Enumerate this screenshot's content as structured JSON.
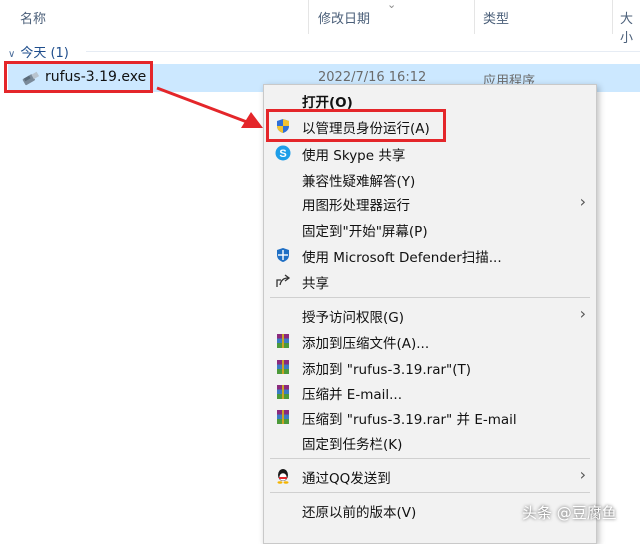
{
  "columns": {
    "name": "名称",
    "modified": "修改日期",
    "type": "类型",
    "size": "大小"
  },
  "group": {
    "label": "今天 (1)"
  },
  "file": {
    "name": "rufus-3.19.exe",
    "date": "2022/7/16 16:12",
    "type": "应用程序"
  },
  "menu": {
    "items": [
      {
        "label": "打开(O)",
        "icon": ""
      },
      {
        "label": "以管理员身份运行(A)",
        "icon": "uac-shield-icon"
      },
      {
        "label": "使用 Skype 共享",
        "icon": "skype-icon"
      },
      {
        "label": "兼容性疑难解答(Y)",
        "icon": ""
      },
      {
        "label": "用图形处理器运行",
        "icon": "",
        "submenu": true
      },
      {
        "label": "固定到\"开始\"屏幕(P)",
        "icon": ""
      },
      {
        "label": "使用 Microsoft Defender扫描...",
        "icon": "defender-icon"
      },
      {
        "label": "共享",
        "icon": "share-icon"
      },
      {
        "label": "授予访问权限(G)",
        "icon": "",
        "submenu": true
      },
      {
        "label": "添加到压缩文件(A)...",
        "icon": "winrar-icon"
      },
      {
        "label": "添加到 \"rufus-3.19.rar\"(T)",
        "icon": "winrar-icon"
      },
      {
        "label": "压缩并 E-mail...",
        "icon": "winrar-icon"
      },
      {
        "label": "压缩到 \"rufus-3.19.rar\" 并 E-mail",
        "icon": "winrar-icon"
      },
      {
        "label": "固定到任务栏(K)",
        "icon": ""
      },
      {
        "label": "通过QQ发送到",
        "icon": "qq-icon",
        "submenu": true
      },
      {
        "label": "还原以前的版本(V)",
        "icon": ""
      }
    ]
  },
  "watermark": "头条 @豆腐鱼",
  "colors": {
    "selection": "#cce8ff",
    "highlight_border": "#e4262a",
    "menu_bg": "#f2f2f2"
  }
}
